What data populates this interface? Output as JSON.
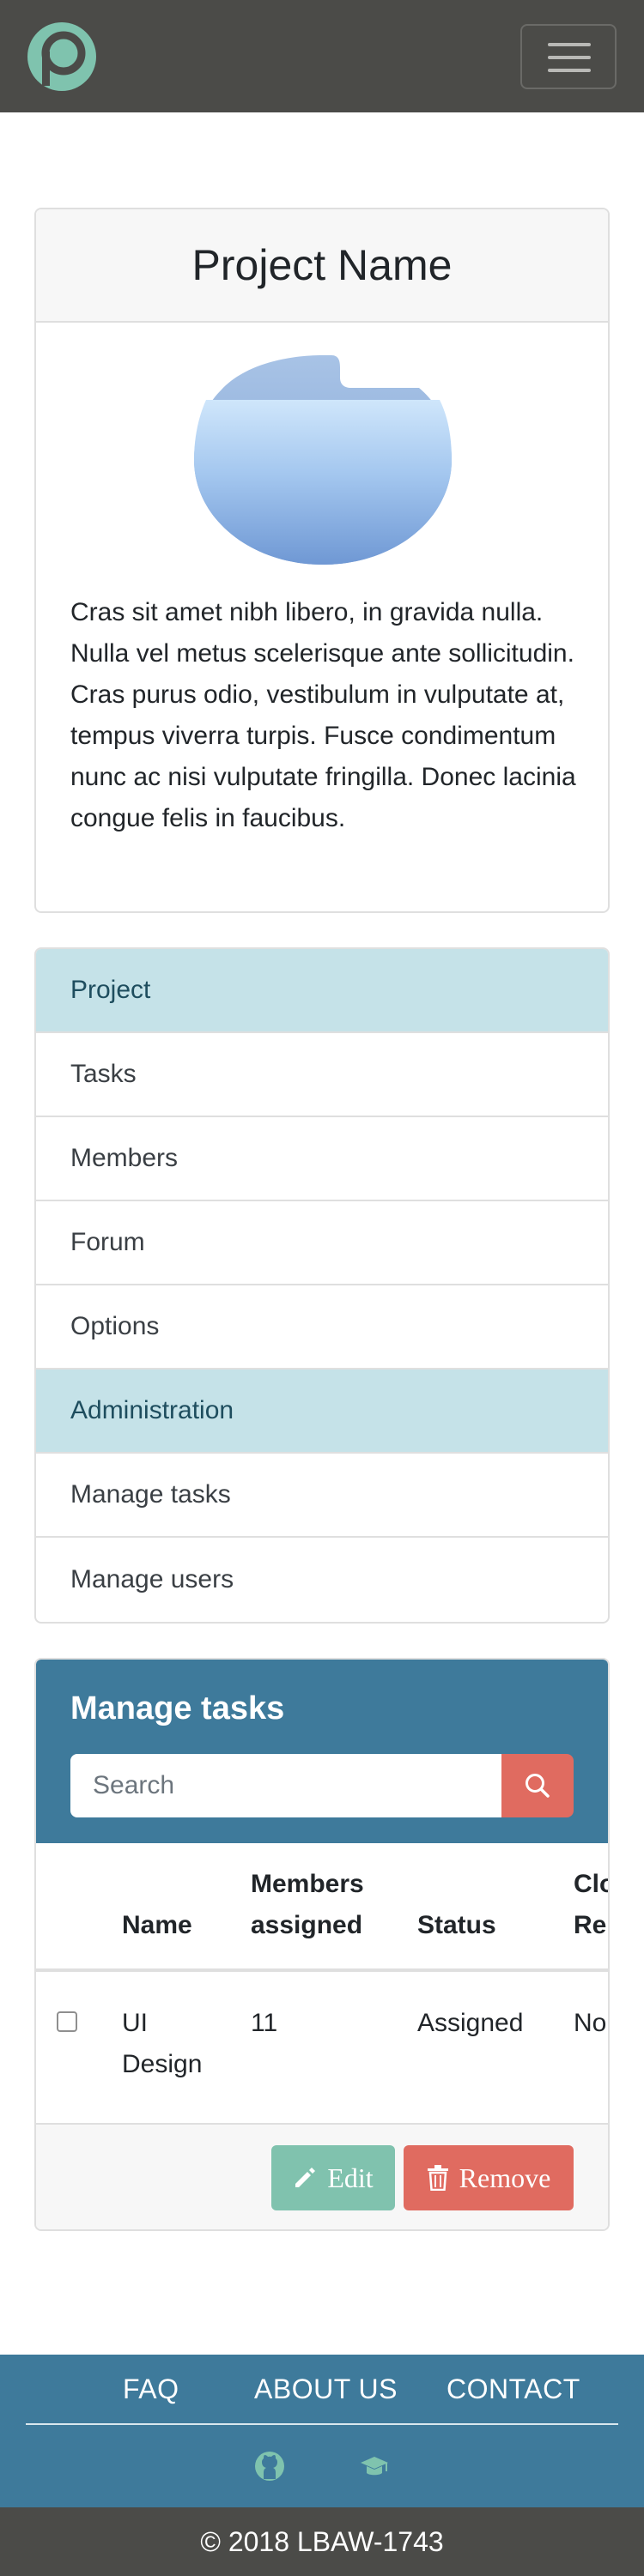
{
  "navbar": {
    "logo_icon": "p-logo-icon",
    "toggle_icon": "hamburger-menu-icon"
  },
  "project": {
    "title": "Project Name",
    "image_icon": "folder-illustration",
    "description": "Cras sit amet nibh libero, in gravida nulla. Nulla vel metus scelerisque ante sollicitudin. Cras purus odio, vestibulum in vulputate at, tempus viverra turpis. Fusce condimentum nunc ac nisi vulputate fringilla. Donec lacinia congue felis in faucibus."
  },
  "menu": {
    "items": [
      {
        "label": "Project",
        "active": true
      },
      {
        "label": "Tasks",
        "active": false
      },
      {
        "label": "Members",
        "active": false
      },
      {
        "label": "Forum",
        "active": false
      },
      {
        "label": "Options",
        "active": false
      },
      {
        "label": "Administration",
        "active": true
      },
      {
        "label": "Manage tasks",
        "active": false
      },
      {
        "label": "Manage users",
        "active": false
      }
    ]
  },
  "manage_tasks": {
    "title": "Manage tasks",
    "search_placeholder": "Search",
    "search_icon": "search-icon",
    "columns": {
      "name": "Name",
      "members_line1": "Members",
      "members_line2": "assigned",
      "status": "Status",
      "closed_line1": "Clo",
      "closed_line2": "Re"
    },
    "rows": [
      {
        "name_line1": "UI",
        "name_line2": "Design",
        "members": "11",
        "status": "Assigned",
        "closed": "No",
        "checked": false
      }
    ],
    "edit_label": "Edit",
    "remove_label": "Remove"
  },
  "footer": {
    "links": [
      "FAQ",
      "ABOUT US",
      "CONTACT"
    ],
    "icons": [
      "github-icon",
      "graduation-cap-icon"
    ],
    "copyright": "© 2018 LBAW-1743"
  },
  "colors": {
    "navbar": "#4b4b48",
    "accent": "#3e7a9b",
    "active_item": "#c5e2e8",
    "danger": "#e06b60",
    "success": "#80c2ae",
    "logo": "#7fc3ae"
  }
}
